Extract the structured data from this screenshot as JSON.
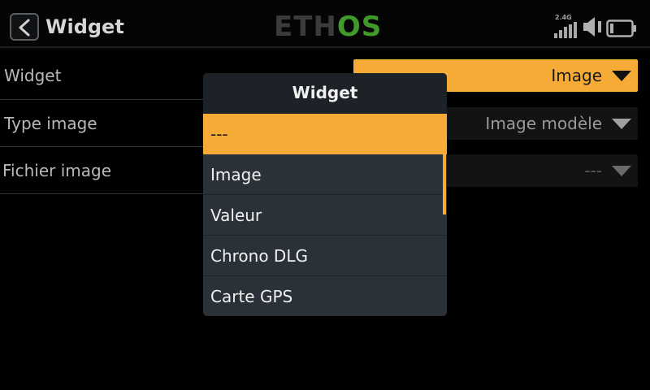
{
  "header": {
    "title": "Widget",
    "logo_left": "ETH",
    "logo_right": "OS",
    "rf_band": "2.4G"
  },
  "settings": [
    {
      "label": "Widget",
      "value": "Image",
      "active": true
    },
    {
      "label": "Type image",
      "value": "Image modèle",
      "active": false
    },
    {
      "label": "Fichier image",
      "value": "---",
      "active": false
    }
  ],
  "popup": {
    "title": "Widget",
    "options": [
      "---",
      "Image",
      "Valeur",
      "Chrono DLG",
      "Carte GPS"
    ],
    "selected_index": 0
  },
  "colors": {
    "accent": "#f5ab36",
    "logo_green": "#3f9a2a",
    "popup_bg": "#2b3138"
  },
  "icons": [
    "back-arrow-icon",
    "signal-strength-icon",
    "speaker-icon",
    "battery-icon",
    "dropdown-arrow-icon"
  ]
}
